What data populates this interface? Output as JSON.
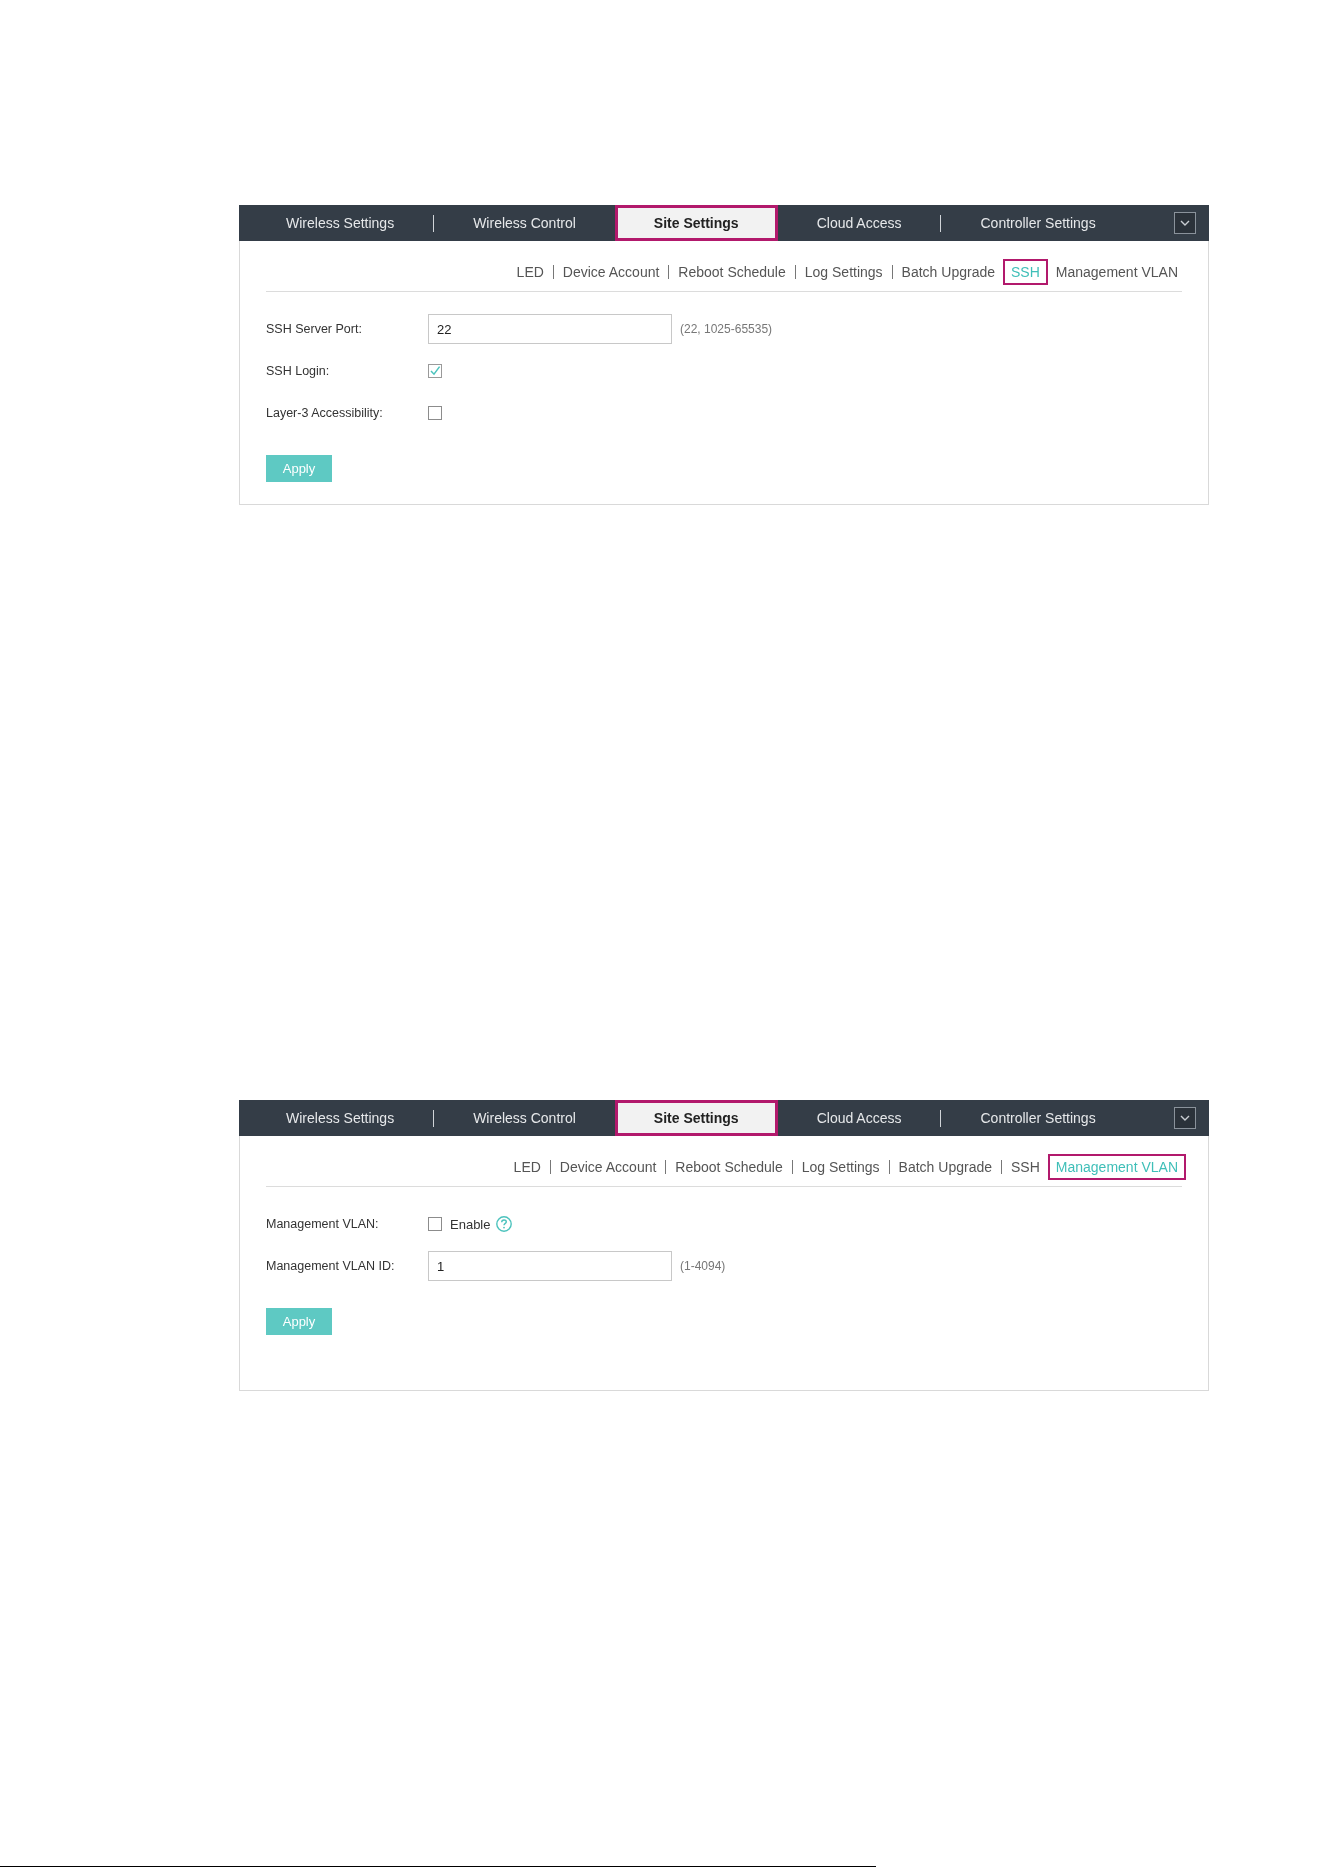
{
  "panels": [
    {
      "tabs": [
        {
          "label": "Wireless Settings",
          "selected": false,
          "highlighted": false
        },
        {
          "label": "Wireless Control",
          "selected": false,
          "highlighted": false
        },
        {
          "label": "Site Settings",
          "selected": true,
          "highlighted": true
        },
        {
          "label": "Cloud Access",
          "selected": false,
          "highlighted": false
        },
        {
          "label": "Controller Settings",
          "selected": false,
          "highlighted": false
        }
      ],
      "subtabs": [
        {
          "label": "LED",
          "selected": false,
          "highlighted": false
        },
        {
          "label": "Device Account",
          "selected": false,
          "highlighted": false
        },
        {
          "label": "Reboot Schedule",
          "selected": false,
          "highlighted": false
        },
        {
          "label": "Log Settings",
          "selected": false,
          "highlighted": false
        },
        {
          "label": "Batch Upgrade",
          "selected": false,
          "highlighted": false
        },
        {
          "label": "SSH",
          "selected": true,
          "highlighted": true
        },
        {
          "label": "Management VLAN",
          "selected": false,
          "highlighted": false
        }
      ],
      "fields": [
        {
          "kind": "text",
          "label": "SSH Server Port:",
          "value": "22",
          "hint": "(22, 1025-65535)"
        },
        {
          "kind": "checkbox",
          "label": "SSH Login:",
          "checked": true
        },
        {
          "kind": "checkbox",
          "label": "Layer-3 Accessibility:",
          "checked": false
        }
      ],
      "button": "Apply"
    },
    {
      "tabs": [
        {
          "label": "Wireless Settings",
          "selected": false,
          "highlighted": false
        },
        {
          "label": "Wireless Control",
          "selected": false,
          "highlighted": false
        },
        {
          "label": "Site Settings",
          "selected": true,
          "highlighted": true
        },
        {
          "label": "Cloud Access",
          "selected": false,
          "highlighted": false
        },
        {
          "label": "Controller Settings",
          "selected": false,
          "highlighted": false
        }
      ],
      "subtabs": [
        {
          "label": "LED",
          "selected": false,
          "highlighted": false
        },
        {
          "label": "Device Account",
          "selected": false,
          "highlighted": false
        },
        {
          "label": "Reboot Schedule",
          "selected": false,
          "highlighted": false
        },
        {
          "label": "Log Settings",
          "selected": false,
          "highlighted": false
        },
        {
          "label": "Batch Upgrade",
          "selected": false,
          "highlighted": false
        },
        {
          "label": "SSH",
          "selected": false,
          "highlighted": false
        },
        {
          "label": "Management VLAN",
          "selected": true,
          "highlighted": true
        }
      ],
      "fields": [
        {
          "kind": "checkbox",
          "label": "Management VLAN:",
          "checked": false,
          "text": "Enable",
          "help": true
        },
        {
          "kind": "text",
          "label": "Management VLAN ID:",
          "value": "1",
          "hint": "(1-4094)"
        }
      ],
      "button": "Apply"
    }
  ]
}
